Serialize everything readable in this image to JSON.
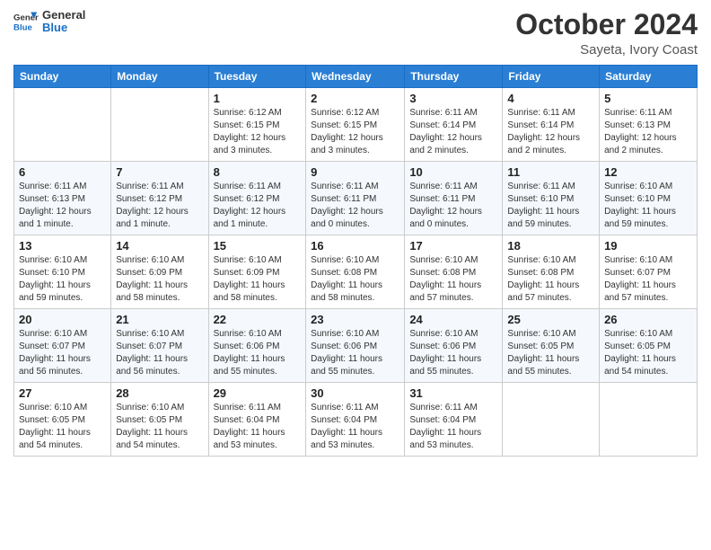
{
  "header": {
    "logo_general": "General",
    "logo_blue": "Blue",
    "month": "October 2024",
    "location": "Sayeta, Ivory Coast"
  },
  "weekdays": [
    "Sunday",
    "Monday",
    "Tuesday",
    "Wednesday",
    "Thursday",
    "Friday",
    "Saturday"
  ],
  "weeks": [
    [
      {
        "day": "",
        "info": ""
      },
      {
        "day": "",
        "info": ""
      },
      {
        "day": "1",
        "info": "Sunrise: 6:12 AM\nSunset: 6:15 PM\nDaylight: 12 hours and 3 minutes."
      },
      {
        "day": "2",
        "info": "Sunrise: 6:12 AM\nSunset: 6:15 PM\nDaylight: 12 hours and 3 minutes."
      },
      {
        "day": "3",
        "info": "Sunrise: 6:11 AM\nSunset: 6:14 PM\nDaylight: 12 hours and 2 minutes."
      },
      {
        "day": "4",
        "info": "Sunrise: 6:11 AM\nSunset: 6:14 PM\nDaylight: 12 hours and 2 minutes."
      },
      {
        "day": "5",
        "info": "Sunrise: 6:11 AM\nSunset: 6:13 PM\nDaylight: 12 hours and 2 minutes."
      }
    ],
    [
      {
        "day": "6",
        "info": "Sunrise: 6:11 AM\nSunset: 6:13 PM\nDaylight: 12 hours and 1 minute."
      },
      {
        "day": "7",
        "info": "Sunrise: 6:11 AM\nSunset: 6:12 PM\nDaylight: 12 hours and 1 minute."
      },
      {
        "day": "8",
        "info": "Sunrise: 6:11 AM\nSunset: 6:12 PM\nDaylight: 12 hours and 1 minute."
      },
      {
        "day": "9",
        "info": "Sunrise: 6:11 AM\nSunset: 6:11 PM\nDaylight: 12 hours and 0 minutes."
      },
      {
        "day": "10",
        "info": "Sunrise: 6:11 AM\nSunset: 6:11 PM\nDaylight: 12 hours and 0 minutes."
      },
      {
        "day": "11",
        "info": "Sunrise: 6:11 AM\nSunset: 6:10 PM\nDaylight: 11 hours and 59 minutes."
      },
      {
        "day": "12",
        "info": "Sunrise: 6:10 AM\nSunset: 6:10 PM\nDaylight: 11 hours and 59 minutes."
      }
    ],
    [
      {
        "day": "13",
        "info": "Sunrise: 6:10 AM\nSunset: 6:10 PM\nDaylight: 11 hours and 59 minutes."
      },
      {
        "day": "14",
        "info": "Sunrise: 6:10 AM\nSunset: 6:09 PM\nDaylight: 11 hours and 58 minutes."
      },
      {
        "day": "15",
        "info": "Sunrise: 6:10 AM\nSunset: 6:09 PM\nDaylight: 11 hours and 58 minutes."
      },
      {
        "day": "16",
        "info": "Sunrise: 6:10 AM\nSunset: 6:08 PM\nDaylight: 11 hours and 58 minutes."
      },
      {
        "day": "17",
        "info": "Sunrise: 6:10 AM\nSunset: 6:08 PM\nDaylight: 11 hours and 57 minutes."
      },
      {
        "day": "18",
        "info": "Sunrise: 6:10 AM\nSunset: 6:08 PM\nDaylight: 11 hours and 57 minutes."
      },
      {
        "day": "19",
        "info": "Sunrise: 6:10 AM\nSunset: 6:07 PM\nDaylight: 11 hours and 57 minutes."
      }
    ],
    [
      {
        "day": "20",
        "info": "Sunrise: 6:10 AM\nSunset: 6:07 PM\nDaylight: 11 hours and 56 minutes."
      },
      {
        "day": "21",
        "info": "Sunrise: 6:10 AM\nSunset: 6:07 PM\nDaylight: 11 hours and 56 minutes."
      },
      {
        "day": "22",
        "info": "Sunrise: 6:10 AM\nSunset: 6:06 PM\nDaylight: 11 hours and 55 minutes."
      },
      {
        "day": "23",
        "info": "Sunrise: 6:10 AM\nSunset: 6:06 PM\nDaylight: 11 hours and 55 minutes."
      },
      {
        "day": "24",
        "info": "Sunrise: 6:10 AM\nSunset: 6:06 PM\nDaylight: 11 hours and 55 minutes."
      },
      {
        "day": "25",
        "info": "Sunrise: 6:10 AM\nSunset: 6:05 PM\nDaylight: 11 hours and 55 minutes."
      },
      {
        "day": "26",
        "info": "Sunrise: 6:10 AM\nSunset: 6:05 PM\nDaylight: 11 hours and 54 minutes."
      }
    ],
    [
      {
        "day": "27",
        "info": "Sunrise: 6:10 AM\nSunset: 6:05 PM\nDaylight: 11 hours and 54 minutes."
      },
      {
        "day": "28",
        "info": "Sunrise: 6:10 AM\nSunset: 6:05 PM\nDaylight: 11 hours and 54 minutes."
      },
      {
        "day": "29",
        "info": "Sunrise: 6:11 AM\nSunset: 6:04 PM\nDaylight: 11 hours and 53 minutes."
      },
      {
        "day": "30",
        "info": "Sunrise: 6:11 AM\nSunset: 6:04 PM\nDaylight: 11 hours and 53 minutes."
      },
      {
        "day": "31",
        "info": "Sunrise: 6:11 AM\nSunset: 6:04 PM\nDaylight: 11 hours and 53 minutes."
      },
      {
        "day": "",
        "info": ""
      },
      {
        "day": "",
        "info": ""
      }
    ]
  ]
}
